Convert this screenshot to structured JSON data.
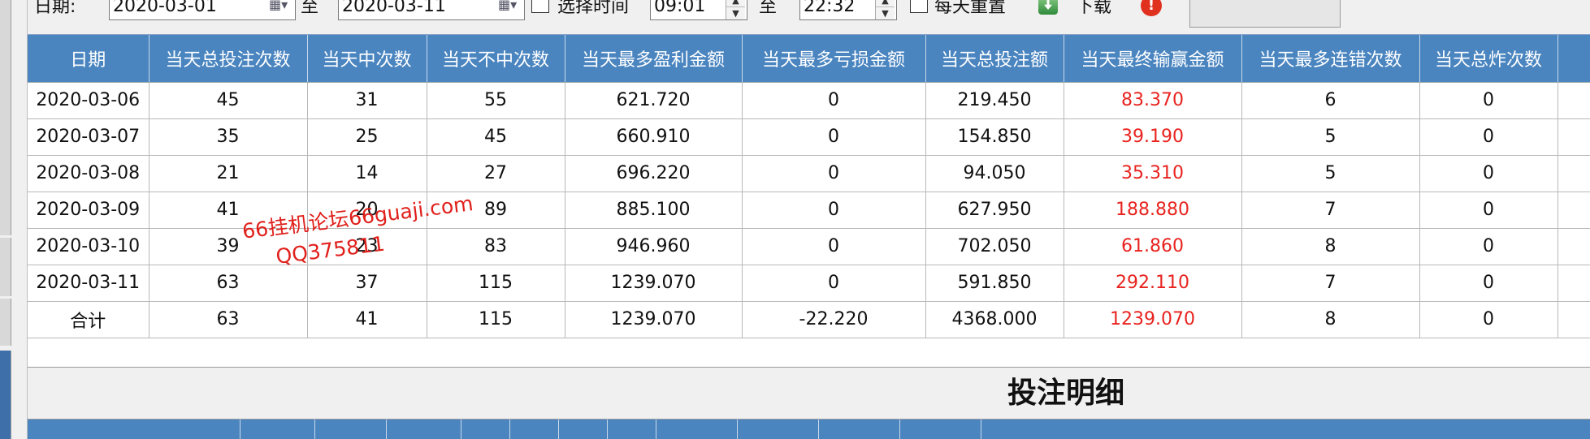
{
  "toolbar": {
    "date_label": "日期:",
    "date_from": "2020-03-01",
    "to_label1": "至",
    "date_to": "2020-03-11",
    "select_time_label": "选择时间",
    "time_from": "09:01",
    "to_label2": "至",
    "time_to": "22:32",
    "daily_reset_label": "每天重置",
    "download_label": "下载"
  },
  "summary_table": {
    "columns": [
      "日期",
      "当天总投注次数",
      "当天中次数",
      "当天不中次数",
      "当天最多盈利金额",
      "当天最多亏损金额",
      "当天总投注额",
      "当天最终输赢金额",
      "当天最多连错次数",
      "当天总炸次数"
    ],
    "rows": [
      [
        "2020-03-06",
        "45",
        "31",
        "55",
        "621.720",
        "0",
        "219.450",
        "83.370",
        "6",
        "0"
      ],
      [
        "2020-03-07",
        "35",
        "25",
        "45",
        "660.910",
        "0",
        "154.850",
        "39.190",
        "5",
        "0"
      ],
      [
        "2020-03-08",
        "21",
        "14",
        "27",
        "696.220",
        "0",
        "94.050",
        "35.310",
        "5",
        "0"
      ],
      [
        "2020-03-09",
        "41",
        "20",
        "89",
        "885.100",
        "0",
        "627.950",
        "188.880",
        "7",
        "0"
      ],
      [
        "2020-03-10",
        "39",
        "23",
        "83",
        "946.960",
        "0",
        "702.050",
        "61.860",
        "8",
        "0"
      ],
      [
        "2020-03-11",
        "63",
        "37",
        "115",
        "1239.070",
        "0",
        "591.850",
        "292.110",
        "7",
        "0"
      ],
      [
        "合计",
        "63",
        "41",
        "115",
        "1239.070",
        "-22.220",
        "4368.000",
        "1239.070",
        "8",
        "0"
      ]
    ]
  },
  "watermark": {
    "line1": "66挂机论坛66guaji.com",
    "line2": "QQ375811"
  },
  "detail": {
    "title": "投注明细"
  },
  "colors": {
    "header_bg": "#4a85c0",
    "win_text": "#e8231f"
  }
}
